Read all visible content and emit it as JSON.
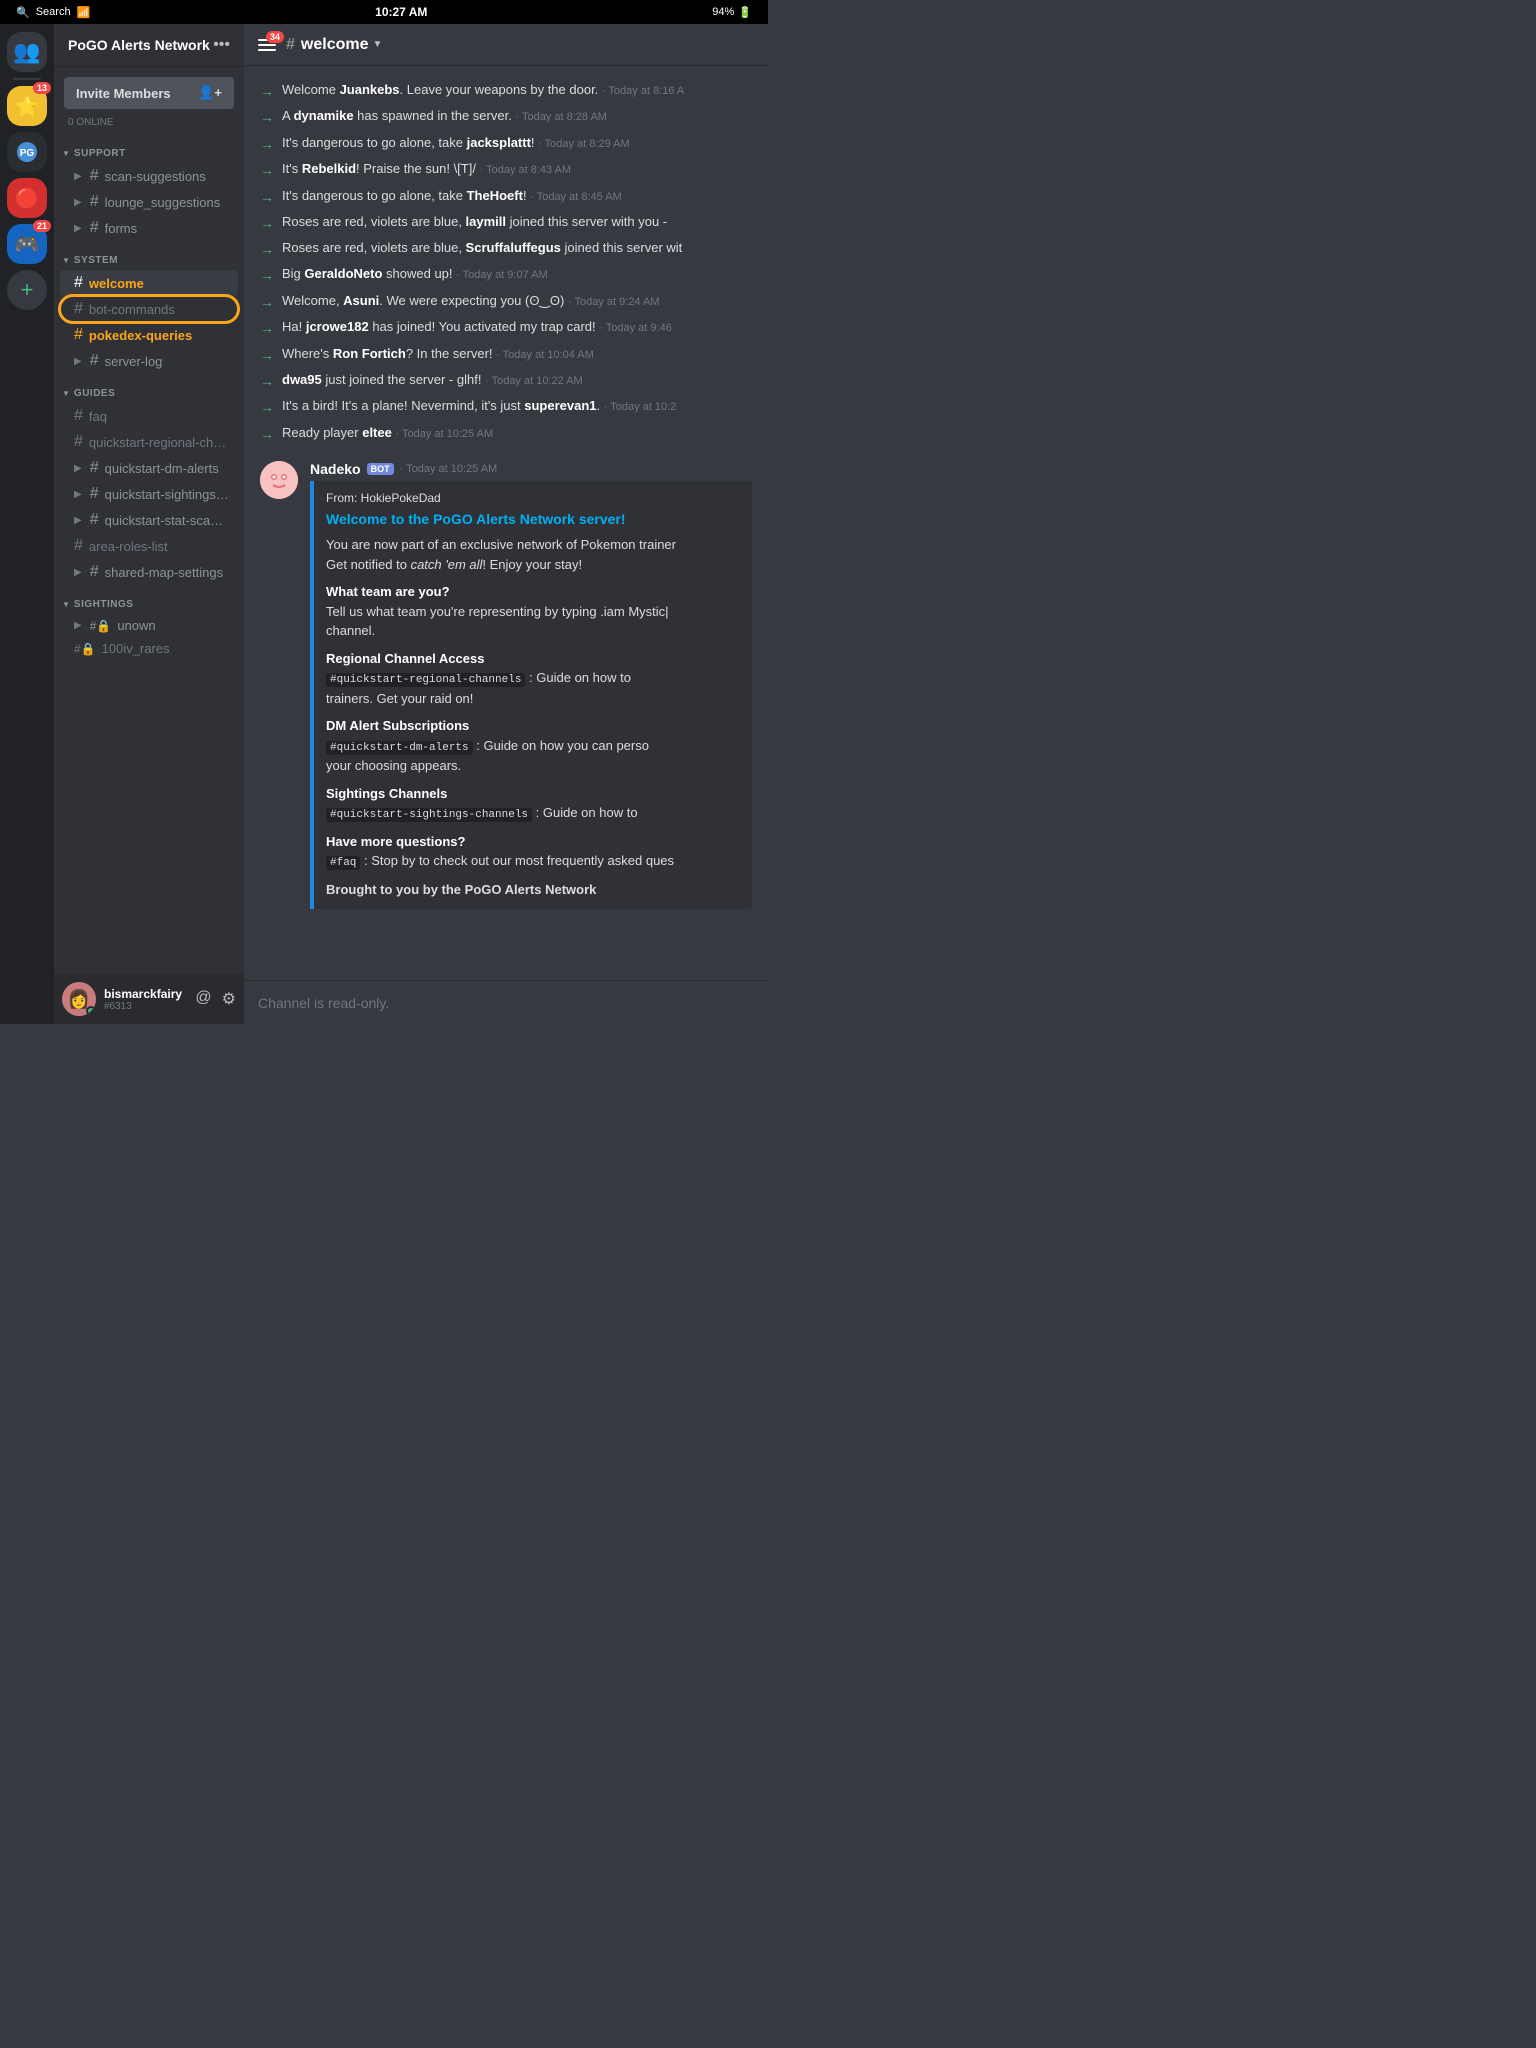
{
  "statusBar": {
    "left": "Search",
    "center": "10:27 AM",
    "right": "94%"
  },
  "serverList": {
    "servers": [
      {
        "id": "home",
        "emoji": "👥",
        "bg": "#4a4f57",
        "badge": null
      },
      {
        "id": "jolteon",
        "emoji": "⭐",
        "bg": "#f0c040",
        "badge": "13"
      },
      {
        "id": "pogo-alerts",
        "emoji": "🌐",
        "bg": "#2a2d31",
        "badge": null
      },
      {
        "id": "pokemon1",
        "emoji": "🔴",
        "bg": "#3a3f47",
        "badge": null
      },
      {
        "id": "pokemon2",
        "emoji": "🎮",
        "bg": "#3a3f47",
        "badge": "21"
      }
    ]
  },
  "sidebar": {
    "serverName": "PoGO Alerts Network",
    "inviteLabel": "Invite Members",
    "onlineCount": "0 ONLINE",
    "categories": [
      {
        "name": "SUPPORT",
        "channels": [
          {
            "name": "scan-suggestions",
            "type": "text",
            "state": "collapsed",
            "active": false
          },
          {
            "name": "lounge_suggestions",
            "type": "text",
            "state": "collapsed",
            "active": false
          },
          {
            "name": "forms",
            "type": "text",
            "state": "collapsed",
            "active": false
          }
        ]
      },
      {
        "name": "SYSTEM",
        "channels": [
          {
            "name": "welcome",
            "type": "text",
            "state": "normal",
            "active": true,
            "highlight": "active"
          },
          {
            "name": "bot-commands",
            "type": "text",
            "state": "normal",
            "active": false,
            "highlight": "ring"
          },
          {
            "name": "pokedex-queries",
            "type": "text",
            "state": "normal",
            "active": false,
            "highlight": "yellow"
          },
          {
            "name": "server-log",
            "type": "text",
            "state": "collapsed",
            "active": false
          }
        ]
      },
      {
        "name": "GUIDES",
        "channels": [
          {
            "name": "faq",
            "type": "text",
            "state": "normal",
            "active": false,
            "muted": true
          },
          {
            "name": "quickstart-regional-chann...",
            "type": "text",
            "state": "normal",
            "active": false,
            "muted": true
          },
          {
            "name": "quickstart-dm-alerts",
            "type": "text",
            "state": "collapsed",
            "active": false
          },
          {
            "name": "quickstart-sightings-chan...",
            "type": "text",
            "state": "collapsed",
            "active": false
          },
          {
            "name": "quickstart-stat-scan-list",
            "type": "text",
            "state": "collapsed",
            "active": false
          },
          {
            "name": "area-roles-list",
            "type": "text",
            "state": "normal",
            "active": false,
            "muted": true
          },
          {
            "name": "shared-map-settings",
            "type": "text",
            "state": "collapsed",
            "active": false
          }
        ]
      },
      {
        "name": "SIGHTINGS",
        "channels": [
          {
            "name": "unown",
            "type": "lock",
            "state": "collapsed",
            "active": false
          },
          {
            "name": "100iv_rares",
            "type": "lock",
            "state": "normal",
            "active": false,
            "muted": true
          }
        ]
      }
    ],
    "user": {
      "name": "bismarckfairy",
      "tag": "#6313",
      "status": "online"
    }
  },
  "chat": {
    "channelName": "welcome",
    "notificationCount": "34",
    "messages": [
      {
        "type": "system",
        "text": "Welcome ",
        "bold": "Juankebs",
        "suffix": ". Leave your weapons by the door.",
        "timestamp": "Today at 8:16 A"
      },
      {
        "type": "system",
        "text": "A ",
        "bold": "dynamike",
        "suffix": " has spawned in the server.",
        "timestamp": "Today at 8:28 AM"
      },
      {
        "type": "system",
        "text": "It's dangerous to go alone, take ",
        "bold": "jacksplattt",
        "suffix": "!",
        "timestamp": "Today at 8:29 AM"
      },
      {
        "type": "system",
        "text": "It's ",
        "bold": "Rebelkid",
        "suffix": "! Praise the sun! \\[T]/",
        "timestamp": "Today at 8:43 AM"
      },
      {
        "type": "system",
        "text": "It's dangerous to go alone, take ",
        "bold": "TheHoeft",
        "suffix": "!",
        "timestamp": "Today at 8:45 AM"
      },
      {
        "type": "system",
        "text": "Roses are red, violets are blue, ",
        "bold": "laymill",
        "suffix": " joined this server with you -",
        "timestamp": ""
      },
      {
        "type": "system",
        "text": "Roses are red, violets are blue, ",
        "bold": "Scruffaluffegus",
        "suffix": " joined this server wit",
        "timestamp": ""
      },
      {
        "type": "system",
        "text": "Big ",
        "bold": "GeraldoNeto",
        "suffix": " showed up!",
        "timestamp": "Today at 9:07 AM"
      },
      {
        "type": "system",
        "text": "Welcome, ",
        "bold": "Asuni",
        "suffix": ". We were expecting you (ʘ‿ʘ)",
        "timestamp": "Today at 9:24 AM"
      },
      {
        "type": "system",
        "text": "Ha! ",
        "bold": "jcrowe182",
        "suffix": " has joined! You activated my trap card!",
        "timestamp": "Today at 9:46"
      },
      {
        "type": "system",
        "text": "Where's ",
        "bold": "Ron Fortich",
        "suffix": "? In the server!",
        "timestamp": "Today at 10:04 AM"
      },
      {
        "type": "system",
        "text": "",
        "bold": "dwa95",
        "suffix": " just joined the server - glhf!",
        "timestamp": "Today at 10:22 AM"
      },
      {
        "type": "system",
        "text": "It's a bird! It's a plane! Nevermind, it's just ",
        "bold": "superevan1",
        "suffix": ".",
        "timestamp": "Today at 10:2"
      },
      {
        "type": "system",
        "text": "Ready player ",
        "bold": "eltee",
        "suffix": "",
        "timestamp": "Today at 10:25 AM"
      }
    ],
    "botMessage": {
      "author": "Nadeko",
      "tag": "BOT",
      "timestamp": "Today at 10:25 AM",
      "avatarEmoji": "🎭",
      "embed": {
        "from": "From: HokiePokeDad",
        "title": "Welcome to the PoGO Alerts Network server!",
        "body": "You are now part of an exclusive network of Pokemon trainer\nGet notified to catch 'em all! Enjoy your stay!\n\nWhat team are you?\nTell us what team you're representing by typing .iam Mystic|\nchannel.\n\nRegional Channel Access\n#quickstart-regional-channels : Guide on how to\ntrainers.  Get your raid on!\n\nDM Alert Subscriptions\n#quickstart-dm-alerts : Guide on how you can perso\nyour choosing appears.\n\nSightings Channels\n#quickstart-sightings-channels : Guide on how to\n\nHave more questions?\n#faq : Stop by to check out our most frequently asked ques\n\nBrought to you by the PoGO Alerts Network"
      }
    },
    "inputPlaceholder": "Channel is read-only."
  }
}
